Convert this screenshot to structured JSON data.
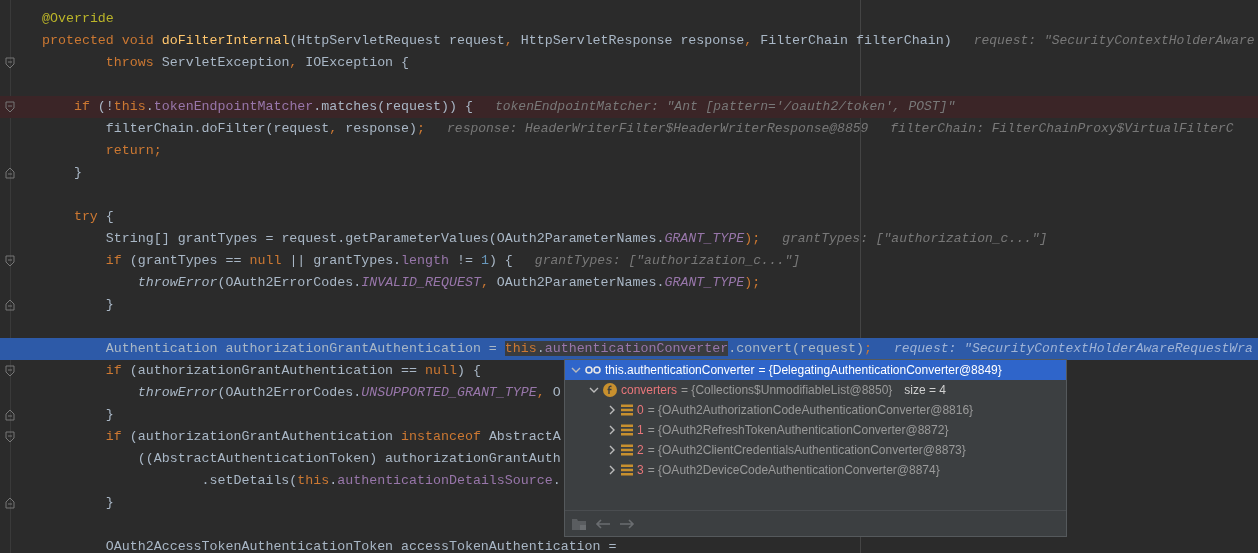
{
  "code_lines": [
    {
      "kind": "code",
      "tokens": [
        {
          "text": "@Override",
          "kind": "annotation"
        }
      ]
    },
    {
      "kind": "code",
      "tokens": [
        {
          "text": "protected void ",
          "kind": "keyword"
        },
        {
          "text": "doFilterInternal",
          "kind": "method"
        },
        {
          "text": "(HttpServletRequest request",
          "kind": "plain"
        },
        {
          "text": ", ",
          "kind": "keyword"
        },
        {
          "text": "HttpServletResponse response",
          "kind": "plain"
        },
        {
          "text": ", ",
          "kind": "keyword"
        },
        {
          "text": "FilterChain filterChain)",
          "kind": "plain"
        }
      ],
      "hints": [
        "request: \"SecurityContextHolderAware"
      ]
    },
    {
      "kind": "code",
      "tokens": [
        {
          "text": "        throws ",
          "kind": "keyword"
        },
        {
          "text": "ServletException",
          "kind": "plain"
        },
        {
          "text": ", ",
          "kind": "keyword"
        },
        {
          "text": "IOException {",
          "kind": "plain"
        }
      ],
      "fold_start": true
    },
    {
      "kind": "blank"
    },
    {
      "kind": "code",
      "tokens": [
        {
          "text": "    if ",
          "kind": "keyword"
        },
        {
          "text": "(!",
          "kind": "plain"
        },
        {
          "text": "this",
          "kind": "keyword"
        },
        {
          "text": ".",
          "kind": "plain"
        },
        {
          "text": "tokenEndpointMatcher",
          "kind": "field"
        },
        {
          "text": ".matches(request)) {",
          "kind": "plain"
        }
      ],
      "hints": [
        "tokenEndpointMatcher: \"Ant [pattern='/oauth2/token', POST]\""
      ],
      "fold_start": true,
      "breakpoint": true
    },
    {
      "kind": "code",
      "tokens": [
        {
          "text": "        filterChain.doFilter(request",
          "kind": "plain"
        },
        {
          "text": ", ",
          "kind": "keyword"
        },
        {
          "text": "response)",
          "kind": "plain"
        },
        {
          "text": ";",
          "kind": "keyword"
        }
      ],
      "hints": [
        "response: HeaderWriterFilter$HeaderWriterResponse@8859",
        "filterChain: FilterChainProxy$VirtualFilterC"
      ]
    },
    {
      "kind": "code",
      "tokens": [
        {
          "text": "        return;",
          "kind": "keyword"
        }
      ]
    },
    {
      "kind": "code",
      "tokens": [
        {
          "text": "    }",
          "kind": "plain"
        }
      ],
      "fold_end": true
    },
    {
      "kind": "blank"
    },
    {
      "kind": "code",
      "tokens": [
        {
          "text": "    try ",
          "kind": "keyword"
        },
        {
          "text": "{",
          "kind": "plain"
        }
      ]
    },
    {
      "kind": "code",
      "tokens": [
        {
          "text": "        String[] grantTypes = request.getParameterValues(OAuth2ParameterNames.",
          "kind": "plain"
        },
        {
          "text": "GRANT_TYPE",
          "kind": "constant"
        },
        {
          "text": ");",
          "kind": "keyword"
        }
      ],
      "hints": [
        "grantTypes: [\"authorization_c...\"]"
      ]
    },
    {
      "kind": "code",
      "tokens": [
        {
          "text": "        if ",
          "kind": "keyword"
        },
        {
          "text": "(grantTypes == ",
          "kind": "plain"
        },
        {
          "text": "null ",
          "kind": "keyword"
        },
        {
          "text": "|| grantTypes.",
          "kind": "plain"
        },
        {
          "text": "length ",
          "kind": "field"
        },
        {
          "text": "!= ",
          "kind": "plain"
        },
        {
          "text": "1",
          "kind": "number"
        },
        {
          "text": ") {",
          "kind": "plain"
        }
      ],
      "hints": [
        "grantTypes: [\"authorization_c...\"]"
      ],
      "fold_start": true
    },
    {
      "kind": "code",
      "tokens": [
        {
          "text": "            throwError",
          "kind": "italic"
        },
        {
          "text": "(OAuth2ErrorCodes.",
          "kind": "plain"
        },
        {
          "text": "INVALID_REQUEST",
          "kind": "constant"
        },
        {
          "text": ", ",
          "kind": "keyword"
        },
        {
          "text": "OAuth2ParameterNames.",
          "kind": "plain"
        },
        {
          "text": "GRANT_TYPE",
          "kind": "constant"
        },
        {
          "text": ");",
          "kind": "keyword"
        }
      ]
    },
    {
      "kind": "code",
      "tokens": [
        {
          "text": "        }",
          "kind": "plain"
        }
      ],
      "fold_end": true
    },
    {
      "kind": "blank"
    },
    {
      "kind": "code",
      "tokens": [
        {
          "text": "        Authentication authorizationGrantAuthentication = ",
          "kind": "plain"
        },
        {
          "text": "this",
          "kind": "keyword",
          "hovered": true
        },
        {
          "text": ".",
          "kind": "plain",
          "hovered": true
        },
        {
          "text": "authenticationConverter",
          "kind": "field",
          "hovered": true
        },
        {
          "text": ".convert(request)",
          "kind": "plain"
        },
        {
          "text": ";",
          "kind": "keyword"
        }
      ],
      "hints": [
        "request: \"SecurityContextHolderAwareRequestWra"
      ],
      "current": true
    },
    {
      "kind": "code",
      "tokens": [
        {
          "text": "        if ",
          "kind": "keyword"
        },
        {
          "text": "(authorizationGrantAuthentication == ",
          "kind": "plain"
        },
        {
          "text": "null",
          "kind": "keyword"
        },
        {
          "text": ") {",
          "kind": "plain"
        }
      ],
      "fold_start": true
    },
    {
      "kind": "code",
      "tokens": [
        {
          "text": "            throwError",
          "kind": "italic"
        },
        {
          "text": "(OAuth2ErrorCodes.",
          "kind": "plain"
        },
        {
          "text": "UNSUPPORTED_GRANT_TYPE",
          "kind": "constant"
        },
        {
          "text": ", ",
          "kind": "keyword"
        },
        {
          "text": "O",
          "kind": "plain"
        }
      ]
    },
    {
      "kind": "code",
      "tokens": [
        {
          "text": "        }",
          "kind": "plain"
        }
      ],
      "fold_end": true
    },
    {
      "kind": "code",
      "tokens": [
        {
          "text": "        if ",
          "kind": "keyword"
        },
        {
          "text": "(authorizationGrantAuthentication ",
          "kind": "plain"
        },
        {
          "text": "instanceof ",
          "kind": "keyword"
        },
        {
          "text": "AbstractA",
          "kind": "plain"
        }
      ],
      "fold_start": true
    },
    {
      "kind": "code",
      "tokens": [
        {
          "text": "            ((AbstractAuthenticationToken) authorizationGrantAuth",
          "kind": "plain"
        }
      ]
    },
    {
      "kind": "code",
      "tokens": [
        {
          "text": "                    .setDetails(",
          "kind": "plain"
        },
        {
          "text": "this",
          "kind": "keyword"
        },
        {
          "text": ".",
          "kind": "plain"
        },
        {
          "text": "authenticationDetailsSource",
          "kind": "field"
        },
        {
          "text": ".",
          "kind": "plain"
        }
      ]
    },
    {
      "kind": "code",
      "tokens": [
        {
          "text": "        }",
          "kind": "plain"
        }
      ],
      "fold_end": true
    },
    {
      "kind": "blank"
    },
    {
      "kind": "code",
      "tokens": [
        {
          "text": "        OAuth2AccessTokenAuthenticationToken accessTokenAuthentication =",
          "kind": "plain"
        }
      ]
    }
  ],
  "debug_popup": {
    "tree": [
      {
        "kind": "watch",
        "name": "this.authenticationConverter",
        "value": "= {DelegatingAuthenticationConverter@8849}",
        "expanded": true,
        "selected": true,
        "children": [
          {
            "kind": "field",
            "name": "converters",
            "value": "= {Collections$UnmodifiableList@8850}",
            "extra": "size = 4",
            "expanded": true,
            "selected": false,
            "children": [
              {
                "kind": "element",
                "name": "0",
                "value": "= {OAuth2AuthorizationCodeAuthenticationConverter@8816}",
                "expanded": false,
                "selected": false
              },
              {
                "kind": "element",
                "name": "1",
                "value": "= {OAuth2RefreshTokenAuthenticationConverter@8872}",
                "expanded": false,
                "selected": false
              },
              {
                "kind": "element",
                "name": "2",
                "value": "= {OAuth2ClientCredentialsAuthenticationConverter@8873}",
                "expanded": false,
                "selected": false
              },
              {
                "kind": "element",
                "name": "3",
                "value": "= {OAuth2DeviceCodeAuthenticationConverter@8874}",
                "expanded": false,
                "selected": false
              }
            ]
          }
        ]
      }
    ]
  }
}
